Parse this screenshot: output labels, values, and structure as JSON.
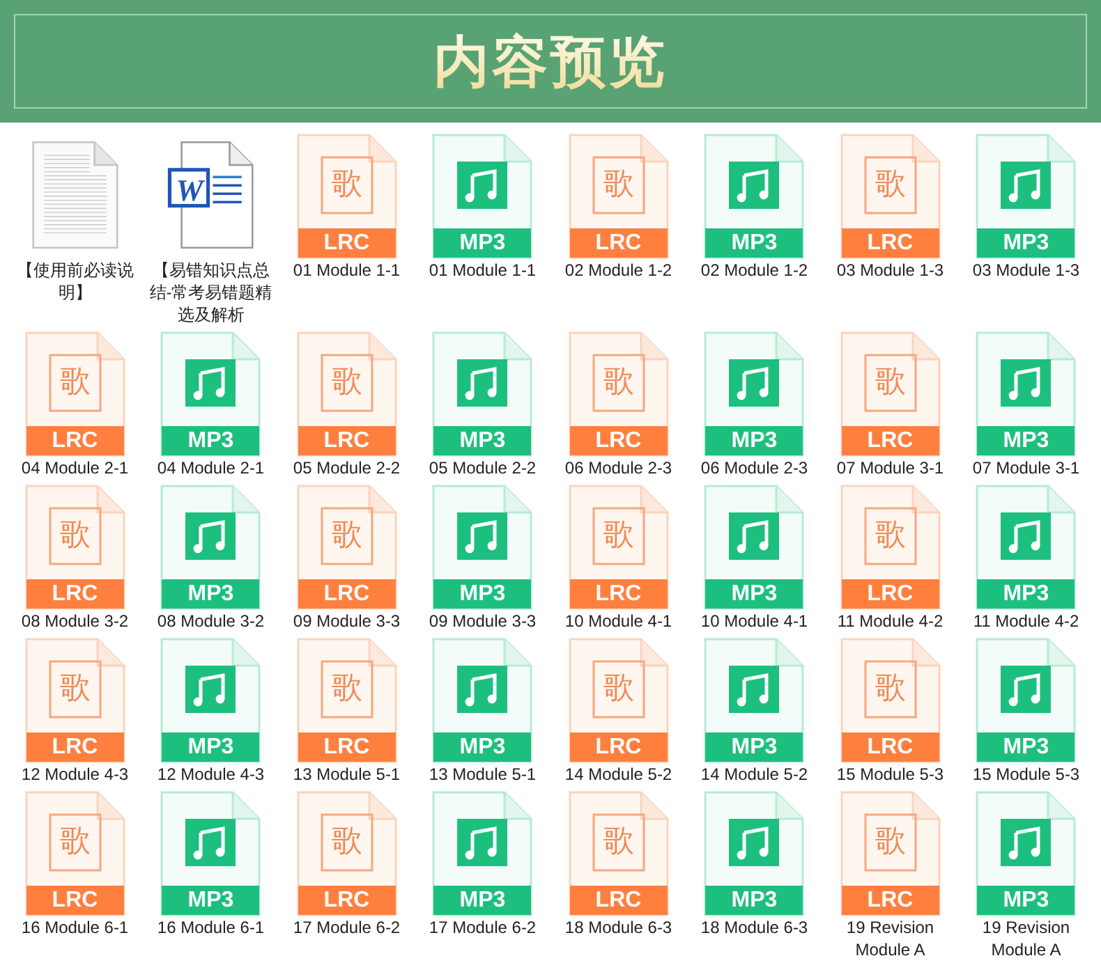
{
  "header": {
    "title": "内容预览"
  },
  "files": [
    {
      "kind": "txt",
      "name": "【使用前必读说明】"
    },
    {
      "kind": "doc",
      "glyph": "W",
      "name": "【易错知识点总结-常考易错题精选及解析"
    },
    {
      "kind": "lrc",
      "glyph": "歌",
      "badge": "LRC",
      "name": "01 Module 1-1"
    },
    {
      "kind": "mp3",
      "badge": "MP3",
      "name": "01 Module 1-1"
    },
    {
      "kind": "lrc",
      "glyph": "歌",
      "badge": "LRC",
      "name": "02 Module 1-2"
    },
    {
      "kind": "mp3",
      "badge": "MP3",
      "name": "02 Module 1-2"
    },
    {
      "kind": "lrc",
      "glyph": "歌",
      "badge": "LRC",
      "name": "03 Module 1-3"
    },
    {
      "kind": "mp3",
      "badge": "MP3",
      "name": "03 Module 1-3"
    },
    {
      "kind": "lrc",
      "glyph": "歌",
      "badge": "LRC",
      "name": "04 Module 2-1"
    },
    {
      "kind": "mp3",
      "badge": "MP3",
      "name": "04 Module 2-1"
    },
    {
      "kind": "lrc",
      "glyph": "歌",
      "badge": "LRC",
      "name": "05 Module 2-2"
    },
    {
      "kind": "mp3",
      "badge": "MP3",
      "name": "05 Module 2-2"
    },
    {
      "kind": "lrc",
      "glyph": "歌",
      "badge": "LRC",
      "name": "06 Module 2-3"
    },
    {
      "kind": "mp3",
      "badge": "MP3",
      "name": "06 Module 2-3"
    },
    {
      "kind": "lrc",
      "glyph": "歌",
      "badge": "LRC",
      "name": "07 Module 3-1"
    },
    {
      "kind": "mp3",
      "badge": "MP3",
      "name": "07 Module 3-1"
    },
    {
      "kind": "lrc",
      "glyph": "歌",
      "badge": "LRC",
      "name": "08 Module 3-2"
    },
    {
      "kind": "mp3",
      "badge": "MP3",
      "name": "08 Module 3-2"
    },
    {
      "kind": "lrc",
      "glyph": "歌",
      "badge": "LRC",
      "name": "09 Module 3-3"
    },
    {
      "kind": "mp3",
      "badge": "MP3",
      "name": "09 Module 3-3"
    },
    {
      "kind": "lrc",
      "glyph": "歌",
      "badge": "LRC",
      "name": "10 Module 4-1"
    },
    {
      "kind": "mp3",
      "badge": "MP3",
      "name": "10 Module 4-1"
    },
    {
      "kind": "lrc",
      "glyph": "歌",
      "badge": "LRC",
      "name": "11 Module 4-2"
    },
    {
      "kind": "mp3",
      "badge": "MP3",
      "name": "11 Module 4-2"
    },
    {
      "kind": "lrc",
      "glyph": "歌",
      "badge": "LRC",
      "name": "12 Module 4-3"
    },
    {
      "kind": "mp3",
      "badge": "MP3",
      "name": "12 Module 4-3"
    },
    {
      "kind": "lrc",
      "glyph": "歌",
      "badge": "LRC",
      "name": "13 Module 5-1"
    },
    {
      "kind": "mp3",
      "badge": "MP3",
      "name": "13 Module 5-1"
    },
    {
      "kind": "lrc",
      "glyph": "歌",
      "badge": "LRC",
      "name": "14 Module 5-2"
    },
    {
      "kind": "mp3",
      "badge": "MP3",
      "name": "14 Module 5-2"
    },
    {
      "kind": "lrc",
      "glyph": "歌",
      "badge": "LRC",
      "name": "15 Module 5-3"
    },
    {
      "kind": "mp3",
      "badge": "MP3",
      "name": "15 Module 5-3"
    },
    {
      "kind": "lrc",
      "glyph": "歌",
      "badge": "LRC",
      "name": "16 Module 6-1"
    },
    {
      "kind": "mp3",
      "badge": "MP3",
      "name": "16 Module 6-1"
    },
    {
      "kind": "lrc",
      "glyph": "歌",
      "badge": "LRC",
      "name": "17 Module 6-2"
    },
    {
      "kind": "mp3",
      "badge": "MP3",
      "name": "17 Module 6-2"
    },
    {
      "kind": "lrc",
      "glyph": "歌",
      "badge": "LRC",
      "name": "18 Module 6-3"
    },
    {
      "kind": "mp3",
      "badge": "MP3",
      "name": "18 Module 6-3"
    },
    {
      "kind": "lrc",
      "glyph": "歌",
      "badge": "LRC",
      "name": "19 Revision Module A"
    },
    {
      "kind": "mp3",
      "badge": "MP3",
      "name": "19 Revision Module A"
    }
  ]
}
